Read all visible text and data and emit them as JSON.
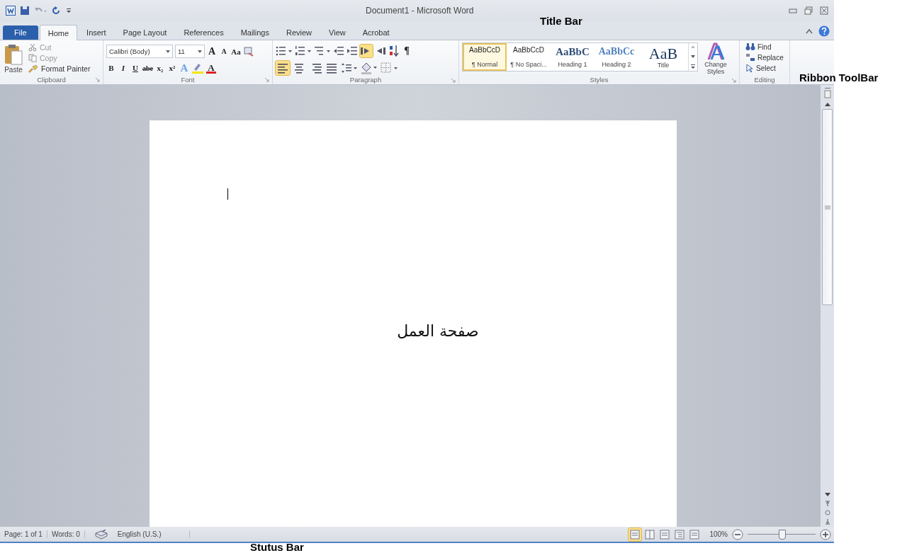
{
  "window": {
    "title": "Document1 - Microsoft Word"
  },
  "tabs": [
    {
      "label": "File",
      "kind": "file",
      "selected": false
    },
    {
      "label": "Home",
      "kind": "tab",
      "selected": true
    },
    {
      "label": "Insert",
      "kind": "tab",
      "selected": false
    },
    {
      "label": "Page Layout",
      "kind": "tab",
      "selected": false
    },
    {
      "label": "References",
      "kind": "tab",
      "selected": false
    },
    {
      "label": "Mailings",
      "kind": "tab",
      "selected": false
    },
    {
      "label": "Review",
      "kind": "tab",
      "selected": false
    },
    {
      "label": "View",
      "kind": "tab",
      "selected": false
    },
    {
      "label": "Acrobat",
      "kind": "tab",
      "selected": false
    }
  ],
  "clipboard": {
    "title": "Clipboard",
    "paste": "Paste",
    "items": [
      {
        "label": "Cut",
        "disabled": true
      },
      {
        "label": "Copy",
        "disabled": true
      },
      {
        "label": "Format Painter",
        "disabled": false
      }
    ]
  },
  "font": {
    "title": "Font",
    "font_name": "Calibri (Body)",
    "font_size": "11",
    "grow": "A",
    "shrink": "A",
    "case": "Aa",
    "format_buttons": [
      "B",
      "I",
      "U",
      "abe",
      "x₂",
      "x²"
    ],
    "color_letter": "A",
    "effects_letter": "A"
  },
  "paragraph": {
    "title": "Paragraph",
    "show_marks": "¶",
    "ltr_selected": true,
    "align": [
      {
        "selected": true
      },
      {
        "selected": false
      },
      {
        "selected": false
      },
      {
        "selected": false
      }
    ]
  },
  "styles": {
    "title": "Styles",
    "items": [
      {
        "preview": "AaBbCcD",
        "name": "¶ Normal",
        "kind": "body",
        "selected": true
      },
      {
        "preview": "AaBbCcD",
        "name": "¶ No Spaci...",
        "kind": "body",
        "selected": false
      },
      {
        "preview": "AaBbC",
        "name": "Heading 1",
        "kind": "heading1",
        "selected": false
      },
      {
        "preview": "AaBbCc",
        "name": "Heading 2",
        "kind": "heading2",
        "selected": false
      },
      {
        "preview": "AaB",
        "name": "Title",
        "kind": "title",
        "selected": false
      }
    ],
    "change_styles": "Change Styles"
  },
  "editing": {
    "title": "Editing",
    "items": [
      {
        "label": "Find",
        "kind": "find"
      },
      {
        "label": "Replace",
        "kind": "replace"
      },
      {
        "label": "Select",
        "kind": "select"
      }
    ]
  },
  "document": {
    "text": "صفحة العمل"
  },
  "status_bar": {
    "page": "Page: 1 of 1",
    "words": "Words: 0",
    "language": "English (U.S.)",
    "views": [
      {
        "selected": true
      },
      {
        "selected": false
      },
      {
        "selected": false
      },
      {
        "selected": false
      },
      {
        "selected": false
      }
    ],
    "zoom": "100%",
    "zoom_level": {
      "level": 0.5
    }
  },
  "annotations": [
    {
      "text": "Title Bar",
      "kind": "title"
    },
    {
      "text": "Ribbon ToolBar",
      "kind": "ribbon"
    },
    {
      "text": "Stutus Bar",
      "kind": "status"
    }
  ]
}
